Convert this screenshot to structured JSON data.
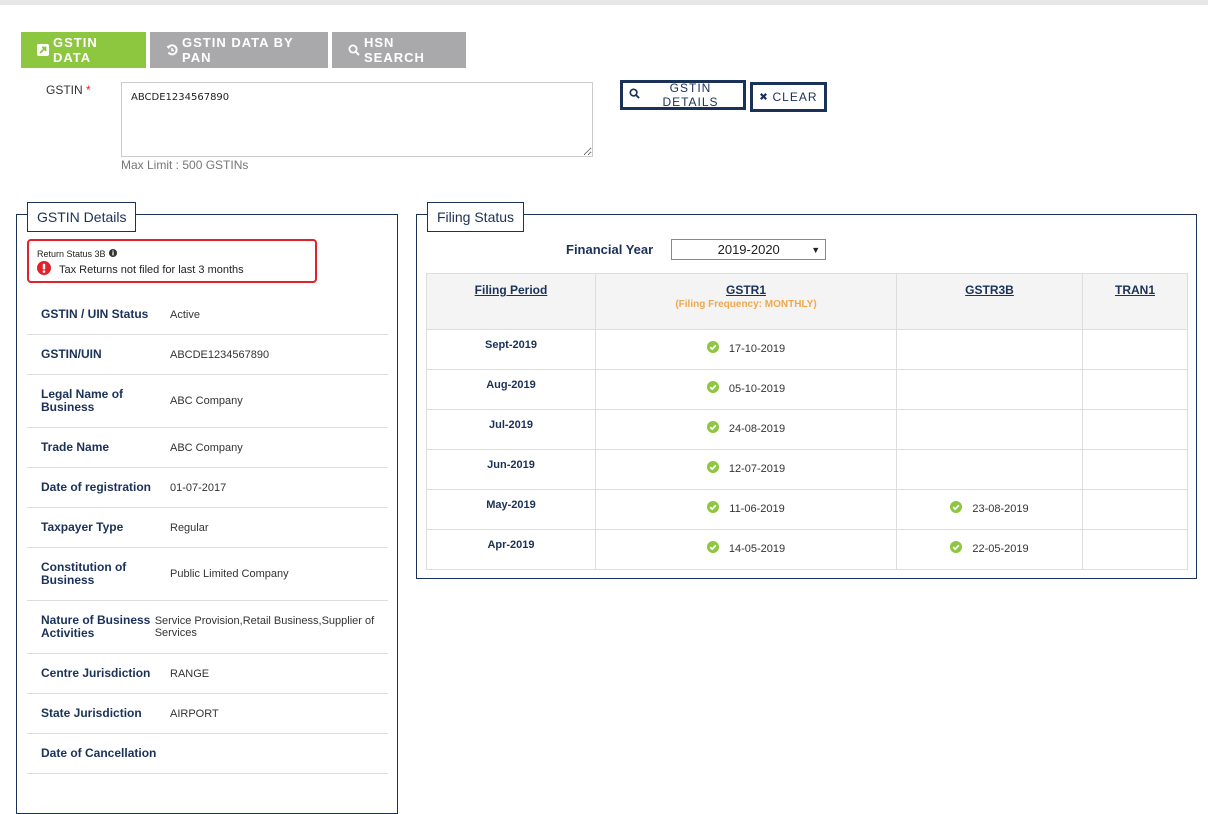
{
  "tabs": [
    {
      "label": "GSTIN DATA",
      "icon": "external-link-icon",
      "active": true
    },
    {
      "label": "GSTIN DATA BY PAN",
      "icon": "history-icon",
      "active": false
    },
    {
      "label": "HSN SEARCH",
      "icon": "search-icon",
      "active": false
    }
  ],
  "form": {
    "gstin_label": "GSTIN",
    "required_mark": "*",
    "gstin_value": "ABCDE1234567890",
    "max_limit": "Max Limit : 500 GSTINs",
    "details_button": "GSTIN DETAILS",
    "clear_button": "CLEAR"
  },
  "gstin_details": {
    "title": "GSTIN Details",
    "alert": {
      "title": "Return Status 3B",
      "message": "Tax Returns not filed for last 3 months"
    },
    "rows": [
      {
        "label": "GSTIN / UIN Status",
        "value": "Active"
      },
      {
        "label": "GSTIN/UIN",
        "value": "ABCDE1234567890"
      },
      {
        "label": "Legal Name of Business",
        "value": "ABC Company"
      },
      {
        "label": "Trade Name",
        "value": "ABC Company"
      },
      {
        "label": "Date of registration",
        "value": "01-07-2017"
      },
      {
        "label": "Taxpayer Type",
        "value": "Regular"
      },
      {
        "label": "Constitution of Business",
        "value": "Public Limited Company"
      },
      {
        "label": "Nature of Business Activities",
        "value": "Service Provision,Retail Business,Supplier of Services"
      },
      {
        "label": "Centre Jurisdiction",
        "value": "RANGE"
      },
      {
        "label": "State Jurisdiction",
        "value": "AIRPORT"
      },
      {
        "label": "Date of Cancellation",
        "value": ""
      }
    ]
  },
  "filing_status": {
    "title": "Filing Status",
    "financial_year_label": "Financial Year",
    "financial_year_value": "2019-2020",
    "columns": {
      "period": "Filing Period",
      "gstr1": "GSTR1",
      "gstr1_freq": "(Filing Frequency: MONTHLY)",
      "gstr3b": "GSTR3B",
      "tran1": "TRAN1"
    },
    "rows": [
      {
        "period": "Sept-2019",
        "gstr1": "17-10-2019",
        "gstr3b": "",
        "tran1": ""
      },
      {
        "period": "Aug-2019",
        "gstr1": "05-10-2019",
        "gstr3b": "",
        "tran1": ""
      },
      {
        "period": "Jul-2019",
        "gstr1": "24-08-2019",
        "gstr3b": "",
        "tran1": ""
      },
      {
        "period": "Jun-2019",
        "gstr1": "12-07-2019",
        "gstr3b": "",
        "tran1": ""
      },
      {
        "period": "May-2019",
        "gstr1": "11-06-2019",
        "gstr3b": "23-08-2019",
        "tran1": ""
      },
      {
        "period": "Apr-2019",
        "gstr1": "14-05-2019",
        "gstr3b": "22-05-2019",
        "tran1": ""
      }
    ]
  },
  "colors": {
    "active_tab": "#8dc63f",
    "inactive_tab": "#a9a9ab",
    "navy": "#1a3158",
    "alert_red": "#e0232a",
    "check_green": "#8dc63f",
    "freq_orange": "#f0a74d"
  }
}
